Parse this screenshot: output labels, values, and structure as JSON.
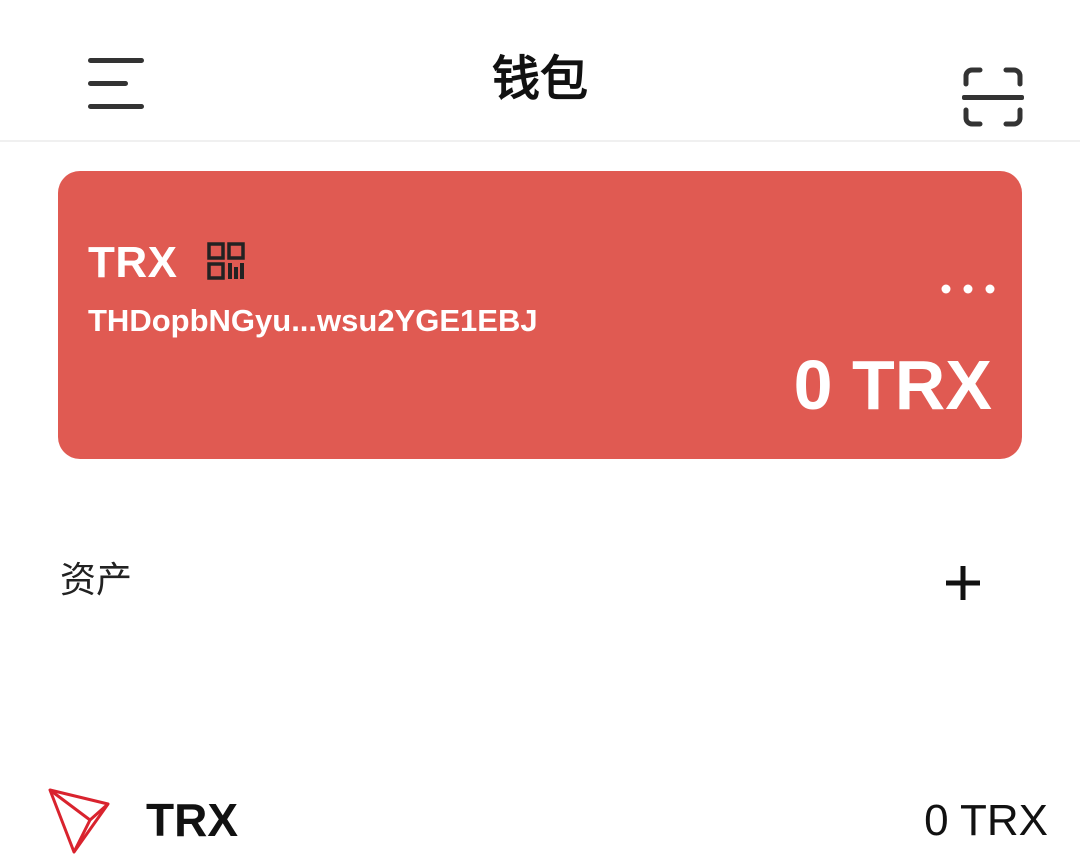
{
  "header": {
    "title": "钱包",
    "menu_icon": "hamburger-menu-icon",
    "scan_icon": "scan-icon"
  },
  "wallet_card": {
    "symbol": "TRX",
    "qr_icon": "qr-code-icon",
    "address": "THDopbNGyu...wsu2YGE1EBJ",
    "more_icon": "more-horizontal-icon",
    "balance": "0 TRX",
    "color": "#e05a52"
  },
  "assets": {
    "label": "资产",
    "add_icon": "plus-icon",
    "items": [
      {
        "name": "TRX",
        "balance": "0 TRX",
        "logo_icon": "tron-logo-icon",
        "logo_color": "#d9232e"
      }
    ]
  }
}
